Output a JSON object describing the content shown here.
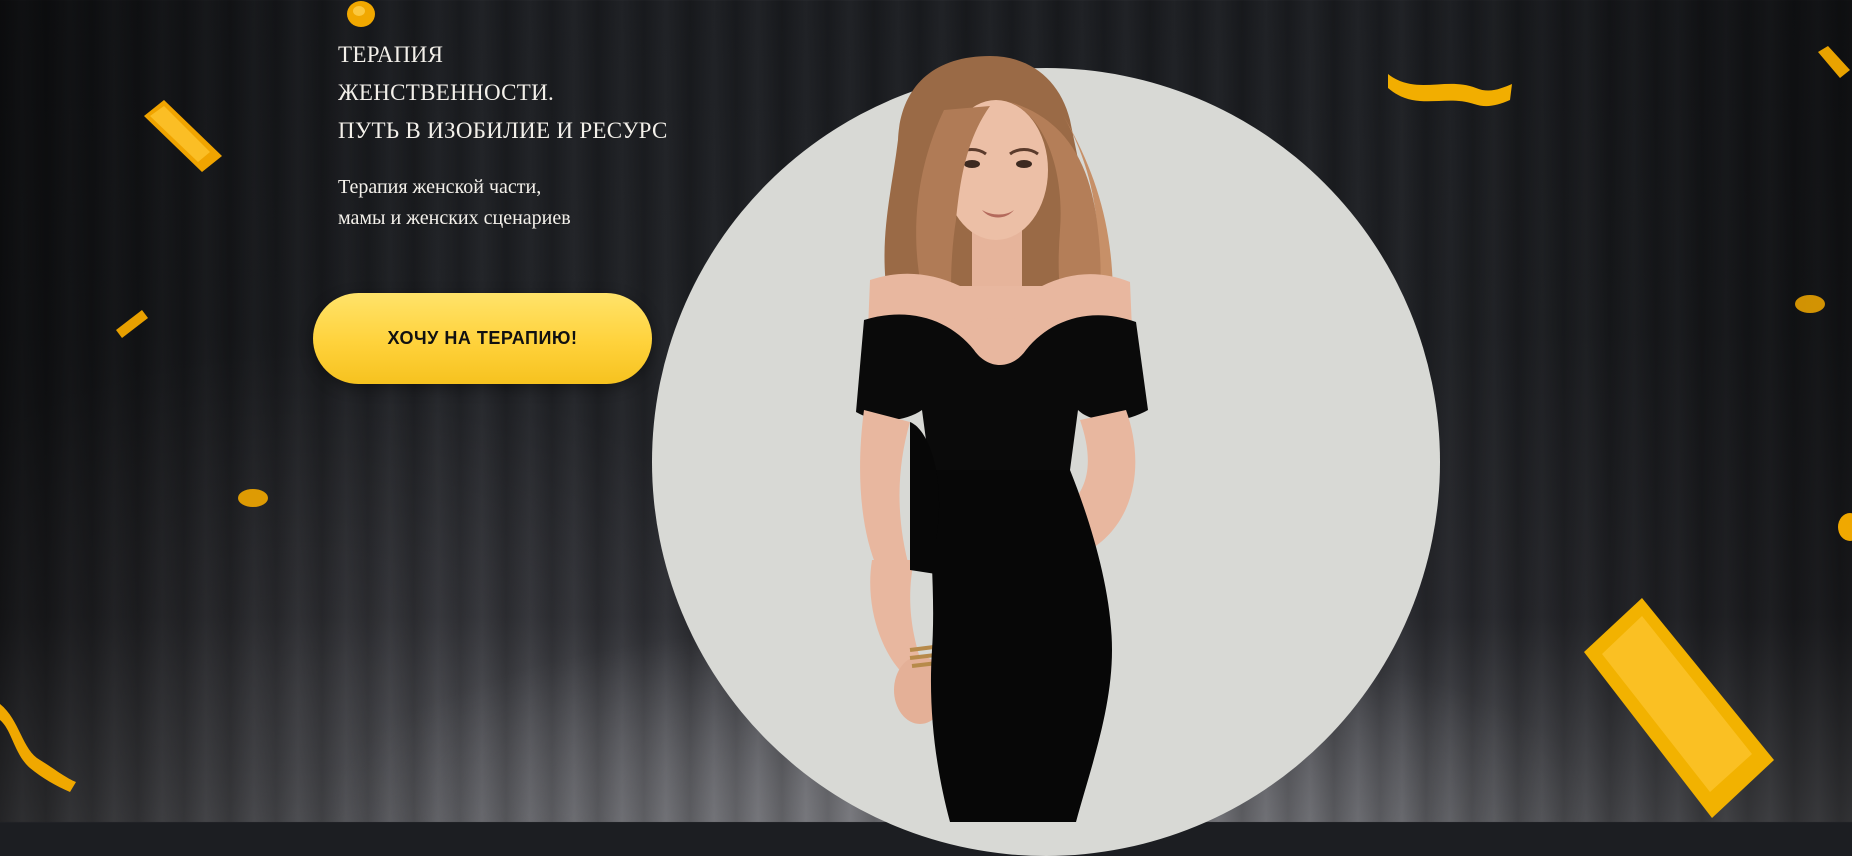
{
  "hero": {
    "title_lines": [
      "ТЕРАПИЯ",
      "ЖЕНСТВЕННОСТИ.",
      "ПУТЬ В ИЗОБИЛИЕ И РЕСУРС"
    ],
    "subtitle_lines": [
      "Терапия женской части,",
      "мамы и женских сценариев"
    ],
    "cta_label": "ХОЧУ НА ТЕРАПИЮ!"
  },
  "colors": {
    "accent": "#ffd23b",
    "gold": "#f5b400",
    "text": "#f3f0ea",
    "circle": "#d8d9d5",
    "background": "#202226"
  }
}
